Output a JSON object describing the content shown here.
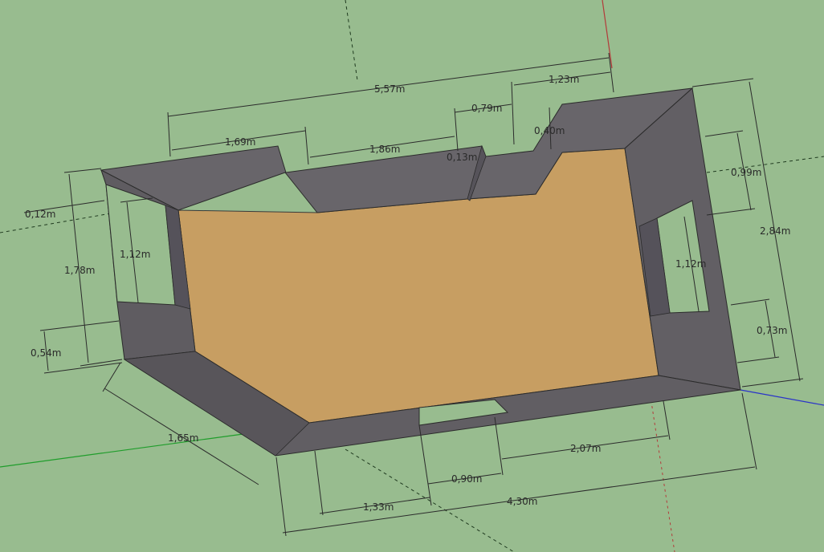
{
  "colors": {
    "ground": "#98bc8f",
    "wall_top": "#6b686c",
    "wall_side": "#58555a",
    "floor": "#c79e62",
    "dimension_line": "#2b2b2b",
    "axis_red": "#b33a3a",
    "axis_green": "#1f9d2b",
    "axis_blue": "#2a33c9"
  },
  "dimensions": {
    "overall_length_top": "5,57m",
    "top_wall_left": "1,69m",
    "top_wall_middle": "1,86m",
    "top_step_width": "0,79m",
    "top_right_segment": "1,23m",
    "top_step_depth_1": "0,40m",
    "top_step_depth_2": "0,13m",
    "left_wall_offset": "0,12m",
    "left_window_height": "1,12m",
    "left_wall_height": "1,78m",
    "left_sill_height": "0,54m",
    "right_wall_top_offset": "0,99m",
    "right_wall_height": "2,84m",
    "right_window_height": "1,12m",
    "right_sill_height": "0,73m",
    "bottom_left_diagonal": "1,65m",
    "bottom_door_width": "0,90m",
    "bottom_right_segment": "2,07m",
    "bottom_left_segment": "1,33m",
    "overall_length_bottom": "4,30m"
  }
}
